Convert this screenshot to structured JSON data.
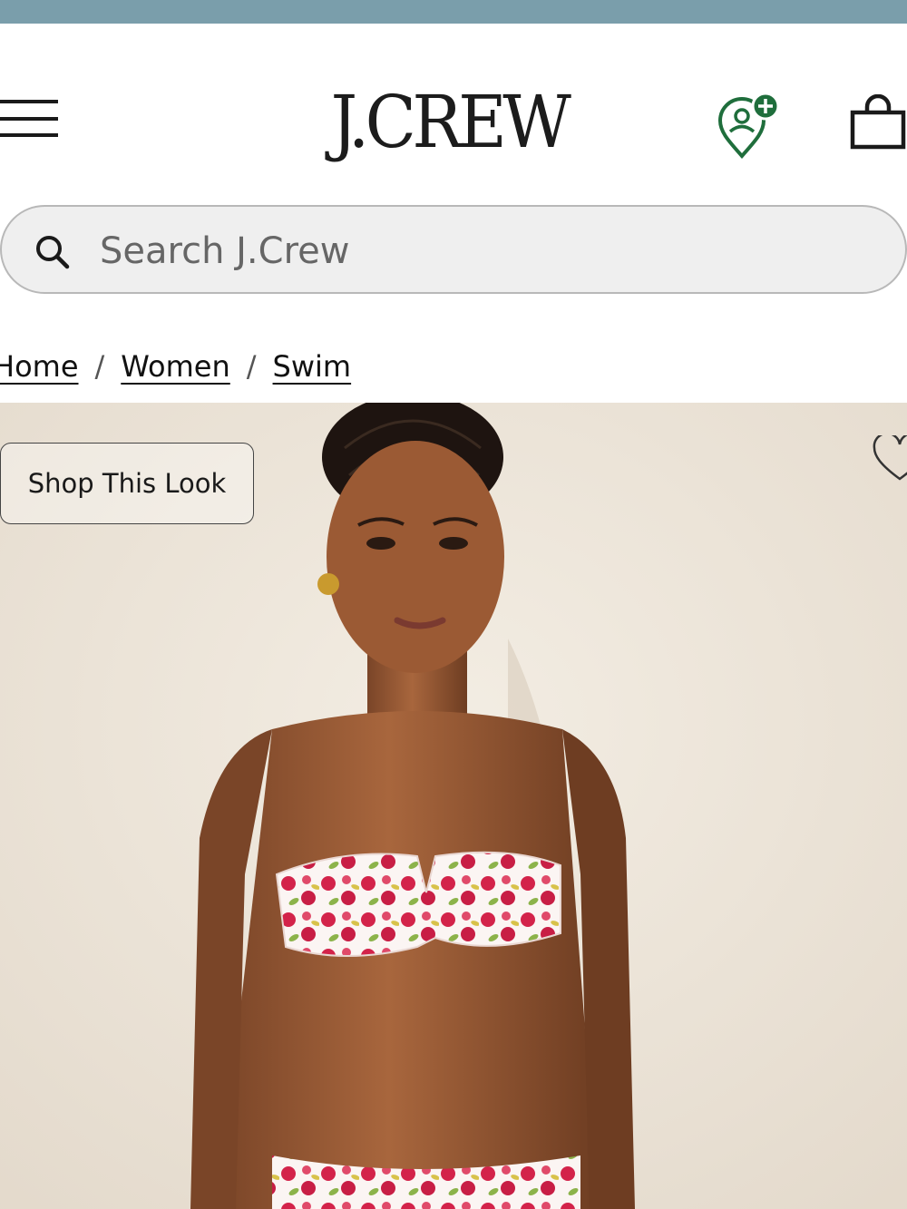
{
  "header": {
    "logo": "J.CREW",
    "menu_icon": "hamburger-menu-icon",
    "rewards_icon": "rewards-location-plus-icon",
    "bag_icon": "shopping-bag-icon"
  },
  "search": {
    "placeholder": "Search J.Crew",
    "value": "",
    "icon": "search-icon"
  },
  "breadcrumb": {
    "items": [
      "Home",
      "Women",
      "Swim"
    ],
    "separator": "/"
  },
  "product": {
    "shop_look_label": "Shop This Look",
    "wishlist_icon": "heart-icon"
  },
  "colors": {
    "top_bar": "#7a9eab",
    "rewards_green": "#1f6e3c",
    "search_bg": "#efefef",
    "hero_bg": "#ede6db"
  }
}
